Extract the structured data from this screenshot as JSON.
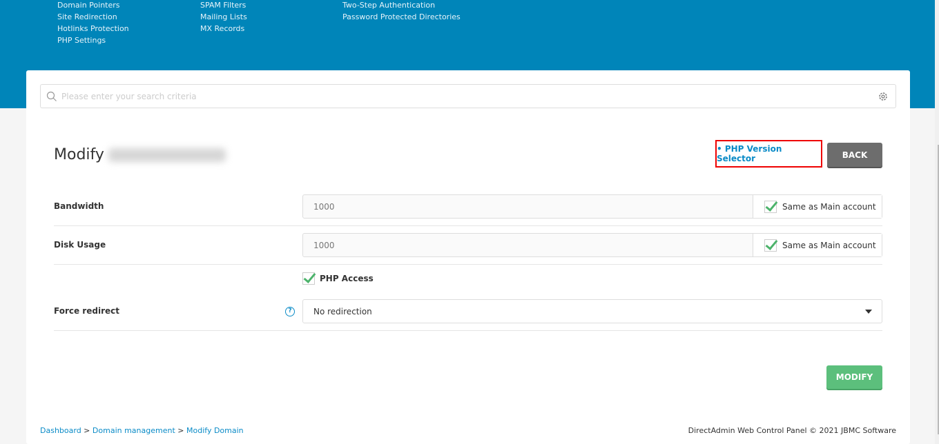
{
  "header": {
    "menu_columns": [
      [
        "Domain Pointers",
        "Site Redirection",
        "Hotlinks Protection",
        "PHP Settings"
      ],
      [
        "SPAM Filters",
        "Mailing Lists",
        "MX Records"
      ],
      [
        "Two-Step Authentication",
        "Password Protected Directories"
      ]
    ]
  },
  "search": {
    "placeholder": "Please enter your search criteria",
    "icon": "search-icon",
    "settings_icon": "gear-icon"
  },
  "page": {
    "title": "Modify",
    "php_version_selector": "• PHP Version Selector",
    "back": "BACK"
  },
  "form": {
    "bandwidth": {
      "label": "Bandwidth",
      "value": "1000",
      "same_label": "Same as Main account",
      "same_checked": true
    },
    "disk": {
      "label": "Disk Usage",
      "value": "1000",
      "same_label": "Same as Main account",
      "same_checked": true
    },
    "php_access": {
      "label": "PHP Access",
      "checked": true
    },
    "force_redirect": {
      "label": "Force redirect",
      "help": "?",
      "selected": "No redirection"
    },
    "submit": "MODIFY"
  },
  "breadcrumb": [
    "Dashboard",
    "Domain management",
    "Modify Domain"
  ],
  "breadcrumb_sep": " > ",
  "footer": "DirectAdmin Web Control Panel © 2021 JBMC Software",
  "colors": {
    "header": "#0085b9",
    "link": "#0a8bc7",
    "modify": "#5cbf7c",
    "back": "#6d6d6d",
    "highlight": "#e00000"
  }
}
